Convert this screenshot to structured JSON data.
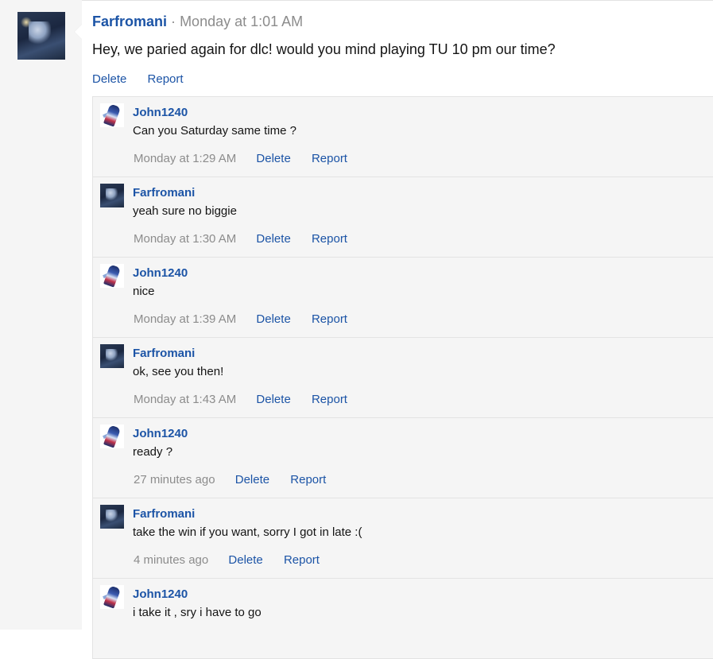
{
  "post": {
    "author": "Farfromani",
    "separator": "·",
    "timestamp": "Monday at 1:01 AM",
    "message": "Hey, we paried again for dlc! would you mind playing TU 10 pm our time?",
    "actions": {
      "delete": "Delete",
      "report": "Report"
    },
    "avatar_icon": "farfromani-avatar-icon"
  },
  "comments": [
    {
      "author": "John1240",
      "text": "Can you Saturday same time ?",
      "time": "Monday at 1:29 AM",
      "delete": "Delete",
      "report": "Report"
    },
    {
      "author": "Farfromani",
      "text": "yeah sure no biggie",
      "time": "Monday at 1:30 AM",
      "delete": "Delete",
      "report": "Report"
    },
    {
      "author": "John1240",
      "text": "nice",
      "time": "Monday at 1:39 AM",
      "delete": "Delete",
      "report": "Report"
    },
    {
      "author": "Farfromani",
      "text": "ok, see you then!",
      "time": "Monday at 1:43 AM",
      "delete": "Delete",
      "report": "Report"
    },
    {
      "author": "John1240",
      "text": "ready ?",
      "time": "27 minutes ago",
      "delete": "Delete",
      "report": "Report"
    },
    {
      "author": "Farfromani",
      "text": "take the win if you want, sorry I got in late :(",
      "time": "4 minutes ago",
      "delete": "Delete",
      "report": "Report"
    },
    {
      "author": "John1240",
      "text": "i take it , sry i have to go",
      "time": "",
      "delete": "",
      "report": ""
    }
  ],
  "colors": {
    "link": "#1c54a6",
    "muted": "#8c8c8c",
    "comment_bg": "#f5f5f5",
    "border": "#e3e3e3"
  }
}
